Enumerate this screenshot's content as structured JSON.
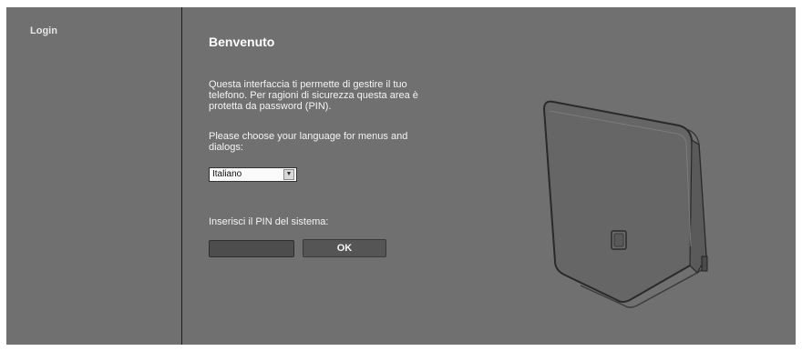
{
  "sidebar": {
    "items": [
      {
        "label": "Login"
      }
    ]
  },
  "main": {
    "title": "Benvenuto",
    "intro": "Questa interfaccia ti permette di gestire il tuo telefono. Per ragioni di sicurezza questa area è protetta da password (PIN).",
    "language_prompt": "Please choose your language for menus and dialogs:",
    "language_select": {
      "value": "Italiano"
    },
    "pin_label": "Inserisci il PIN del sistema:",
    "pin_input": {
      "value": ""
    },
    "ok_label": "OK"
  },
  "illustration": {
    "icon": "base-station-device-illustration"
  },
  "colors": {
    "background": "#707070",
    "divider": "#1e1e1e",
    "text": "#f4f4f4",
    "button": "#555555",
    "input": "#4d4d4d"
  }
}
